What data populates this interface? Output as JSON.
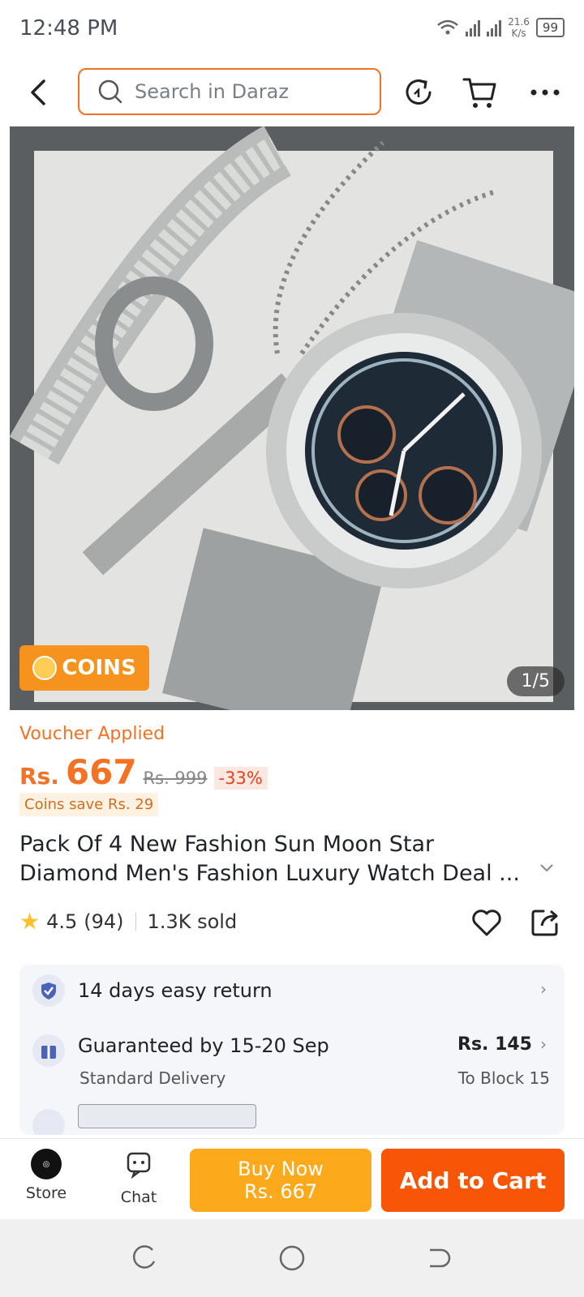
{
  "status_bar": {
    "time": "12:48 PM",
    "speed_value": "21.6",
    "speed_unit": "K/s",
    "battery": "99"
  },
  "topbar": {
    "search_placeholder": "Search in Daraz"
  },
  "hero": {
    "coins_badge": "COINS",
    "pager": "1/5"
  },
  "price": {
    "voucher_label": "Voucher Applied",
    "currency": "Rs.",
    "amount": "667",
    "original": "Rs. 999",
    "discount": "-33%",
    "coins_save": "Coins save Rs. 29"
  },
  "product": {
    "title": "Pack Of 4 New Fashion Sun Moon Star Diamond  Men's Fashion Luxury  Watch Deal  ...",
    "rating": "4.5",
    "reviews": "(94)",
    "sold": "1.3K sold"
  },
  "services": {
    "return_label": "14 days easy return",
    "delivery_label": "Guaranteed by 15-20 Sep",
    "delivery_sub": "Standard Delivery",
    "delivery_price": "Rs. 145",
    "delivery_location": "To Block 15"
  },
  "bottom_bar": {
    "store_label": "Store",
    "chat_label": "Chat",
    "buy_now_label": "Buy Now",
    "buy_now_price": "Rs. 667",
    "add_to_cart_label": "Add to Cart"
  },
  "colors": {
    "accent": "#f57224",
    "buy_now": "#fcaa1b",
    "add_to_cart": "#f85606"
  }
}
